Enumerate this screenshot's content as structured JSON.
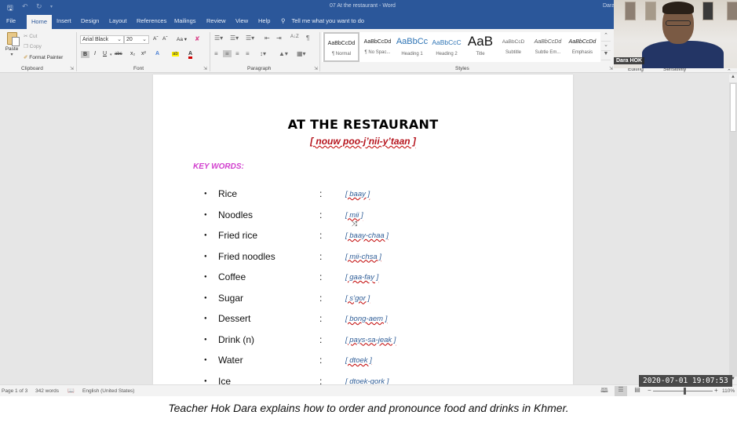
{
  "window": {
    "document_title": "07 At the restaurant",
    "app_name": "Word",
    "title_text": "07 At the restaurant  -  Word",
    "user_partial": "Dara",
    "quick_access": [
      "save-icon",
      "undo-icon",
      "redo-icon",
      "customize-icon"
    ]
  },
  "tabs": [
    {
      "label": "File",
      "active": false
    },
    {
      "label": "Home",
      "active": true
    },
    {
      "label": "Insert",
      "active": false
    },
    {
      "label": "Design",
      "active": false
    },
    {
      "label": "Layout",
      "active": false
    },
    {
      "label": "References",
      "active": false
    },
    {
      "label": "Mailings",
      "active": false
    },
    {
      "label": "Review",
      "active": false
    },
    {
      "label": "View",
      "active": false
    },
    {
      "label": "Help",
      "active": false
    }
  ],
  "tell_me": "Tell me what you want to do",
  "ribbon": {
    "clipboard": {
      "paste": "Paste",
      "cut": "Cut",
      "copy": "Copy",
      "format_painter": "Format Painter",
      "label": "Clipboard"
    },
    "font": {
      "font_name": "Arial Black",
      "font_size": "20",
      "grow": "Aˆ",
      "shrink": "Aˇ",
      "change_case": "Aa",
      "bold": "B",
      "italic": "I",
      "underline": "U",
      "strike": "abc",
      "subscript": "x₂",
      "superscript": "x²",
      "text_effects": "A",
      "highlight": "ab",
      "font_color": "A",
      "label": "Font"
    },
    "paragraph": {
      "label": "Paragraph",
      "sort": "A↓Z",
      "pilcrow": "¶"
    },
    "styles": {
      "label": "Styles",
      "items": [
        {
          "sample": "AaBbCcDd",
          "name": "¶ Normal",
          "active": true
        },
        {
          "sample": "AaBbCcDd",
          "name": "¶ No Spac...",
          "active": false
        },
        {
          "sample": "AaBbCc",
          "name": "Heading 1",
          "active": false
        },
        {
          "sample": "AaBbCcC",
          "name": "Heading 2",
          "active": false
        },
        {
          "sample": "AaB",
          "name": "Title",
          "active": false
        },
        {
          "sample": "AaBbCcD",
          "name": "Subtitle",
          "active": false
        },
        {
          "sample": "AaBbCcDd",
          "name": "Subtle Em...",
          "active": false
        },
        {
          "sample": "AaBbCcDd",
          "name": "Emphasis",
          "active": false
        }
      ]
    },
    "editing_label": "Editing",
    "sensitivity_label": "Sensitivity"
  },
  "webcam": {
    "participant_name": "Dara HOK"
  },
  "document": {
    "title": "AT THE RESTAURANT",
    "title_phonetic": "[ nouw  poo-j’nii-y’taan ]",
    "keywords_heading": "KEY WORDS:",
    "separator": ":",
    "keywords": [
      {
        "term": "Rice",
        "phonetic": "[ baay ]"
      },
      {
        "term": "Noodles",
        "phonetic": "[ mii ]"
      },
      {
        "term": "Fried rice",
        "phonetic": "[ baay-chaa ]"
      },
      {
        "term": "Fried noodles",
        "phonetic": "[ mii-chsa ]"
      },
      {
        "term": "Coffee",
        "phonetic": "[ gaa-fay ]"
      },
      {
        "term": "Sugar",
        "phonetic": "[ s’gor ]"
      },
      {
        "term": "Dessert",
        "phonetic": "[ bong-aem ]"
      },
      {
        "term": "Drink (n)",
        "phonetic": "[ pays-sa-jeak ]"
      },
      {
        "term": "Water",
        "phonetic": "[ dtoek ]"
      },
      {
        "term": "Ice",
        "phonetic": "[ dtoek-gork ]"
      }
    ]
  },
  "statusbar": {
    "page": "Page 1 of 3",
    "words": "342 words",
    "language": "English (United States)",
    "zoom_minus": "−",
    "zoom_plus": "+",
    "zoom_level": "110%",
    "zoom_percent": 110
  },
  "overlay_timestamp": "2020-07-01  19:07:53",
  "caption": "Teacher Hok Dara explains how to order and pronounce food and drinks in Khmer."
}
